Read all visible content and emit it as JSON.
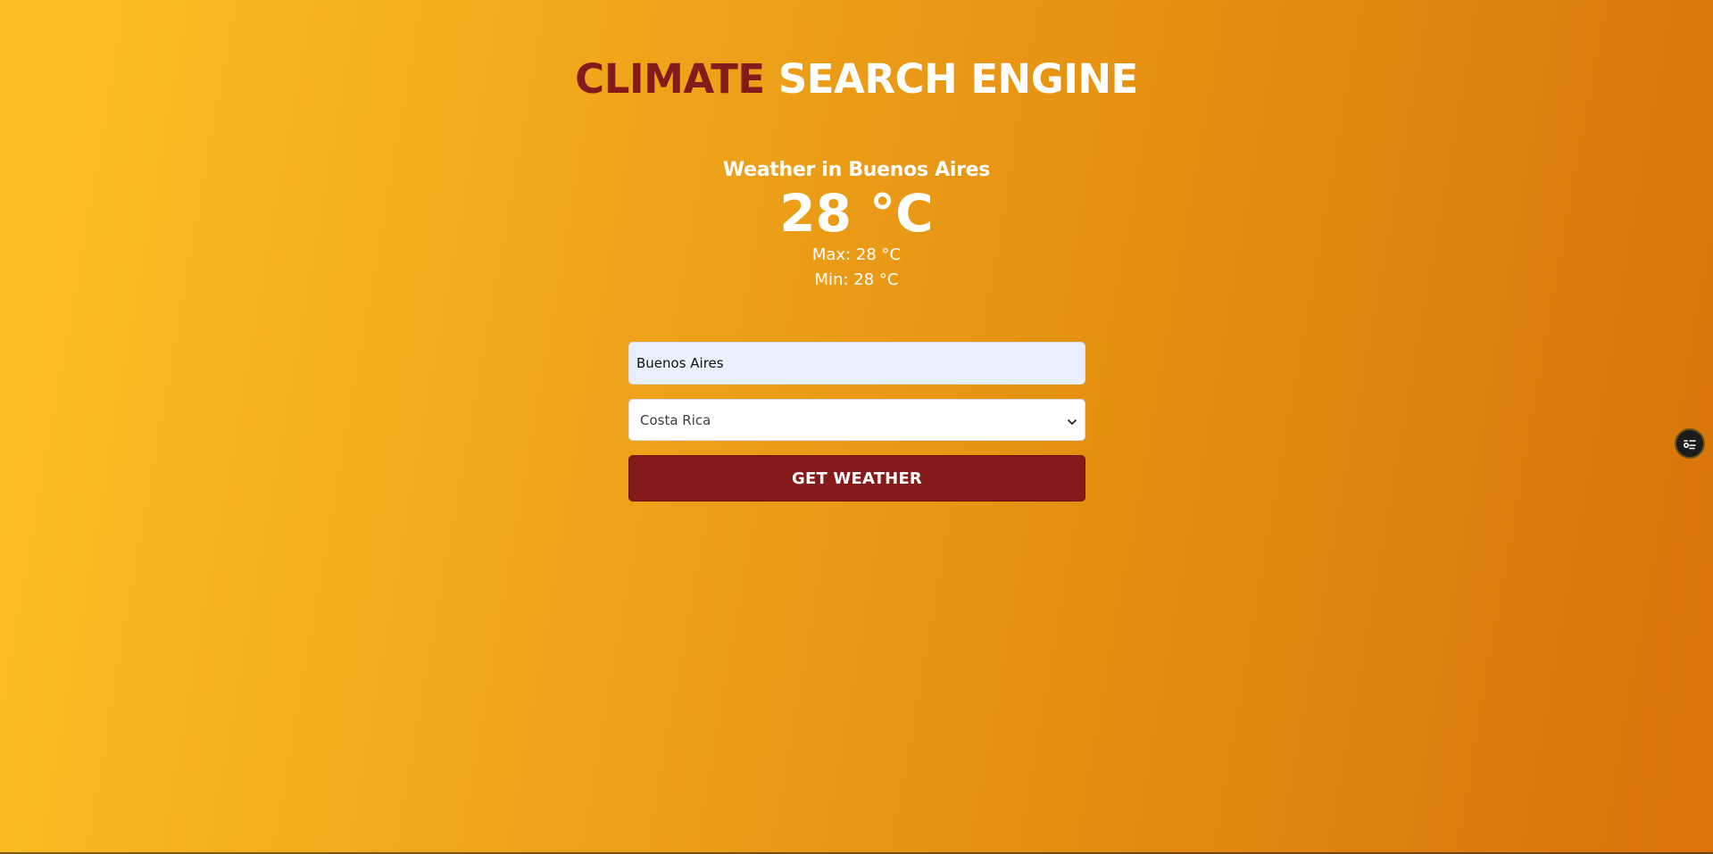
{
  "header": {
    "title_accent": "CLIMATE",
    "title_rest": " SEARCH ENGINE"
  },
  "weather": {
    "heading": "Weather in Buenos Aires",
    "temperature": "28 °C",
    "max": "Max: 28 °C",
    "min": "Min: 28 °C"
  },
  "form": {
    "city_value": "Buenos Aires",
    "country_selected": "Costa Rica",
    "submit_label": "GET WEATHER"
  },
  "floating_button": {
    "icon": "settings-sliders-icon"
  },
  "colors": {
    "accent": "#841a1a",
    "gradient_start": "#fcc124",
    "gradient_end": "#d87309"
  }
}
